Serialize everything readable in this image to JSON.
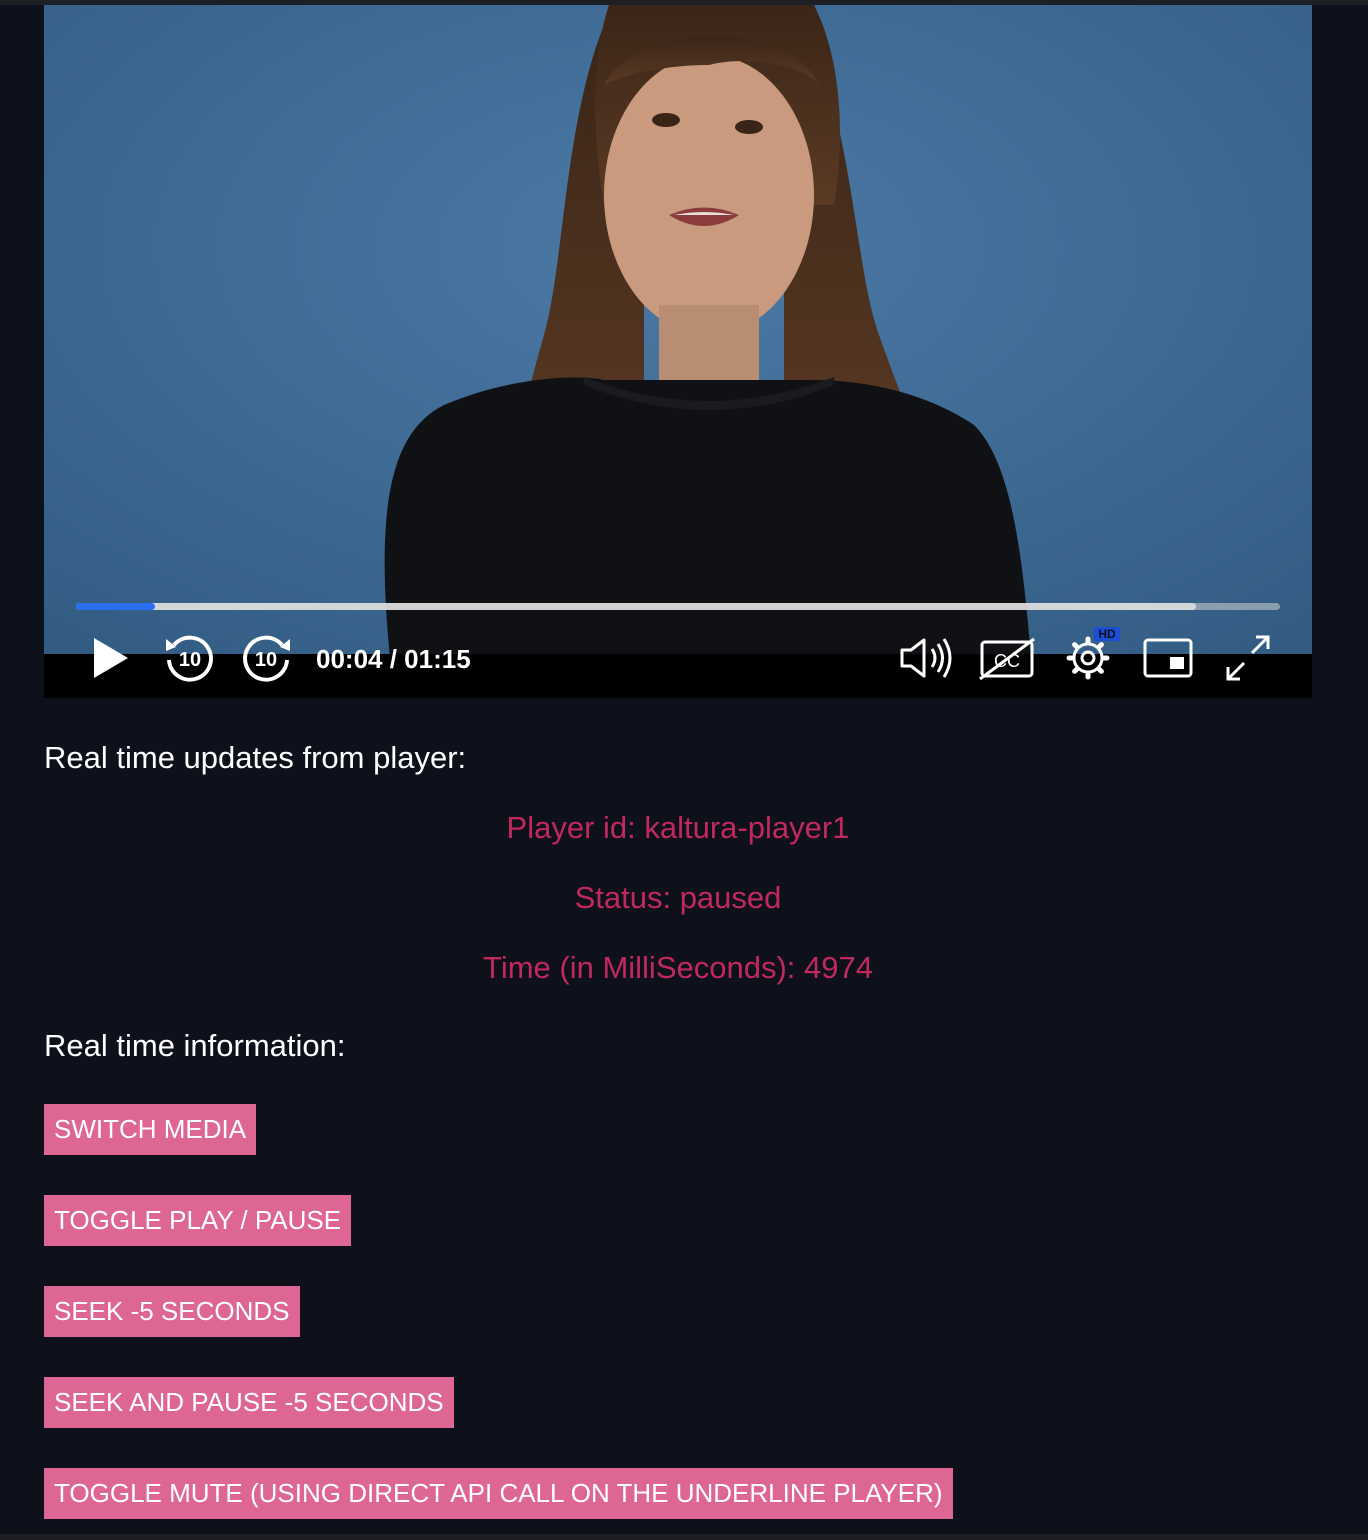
{
  "player": {
    "time_display": "00:04 / 01:15",
    "progress_fraction": 0.066,
    "buffered_fraction": 0.93,
    "accent_color": "#2a6ef1",
    "skip_back_label": "10",
    "skip_forward_label": "10",
    "settings_badge": "HD",
    "icons": [
      "play-icon",
      "rewind-10-icon",
      "forward-10-icon",
      "volume-icon",
      "captions-off-icon",
      "settings-icon",
      "picture-in-picture-icon",
      "fullscreen-icon"
    ]
  },
  "updates": {
    "heading": "Real time updates from player:",
    "player_id": "Player id: kaltura-player1",
    "status": "Status: paused",
    "time": "Time (in MilliSeconds): 4974",
    "text_color": "#c0285e"
  },
  "info": {
    "heading": "Real time information:",
    "button_color": "#dd6694",
    "buttons": [
      "SWITCH MEDIA",
      "TOGGLE PLAY / PAUSE",
      "SEEK -5 SECONDS",
      "SEEK AND PAUSE -5 SECONDS",
      "TOGGLE MUTE (USING DIRECT API CALL ON THE UNDERLINE PLAYER)"
    ]
  }
}
